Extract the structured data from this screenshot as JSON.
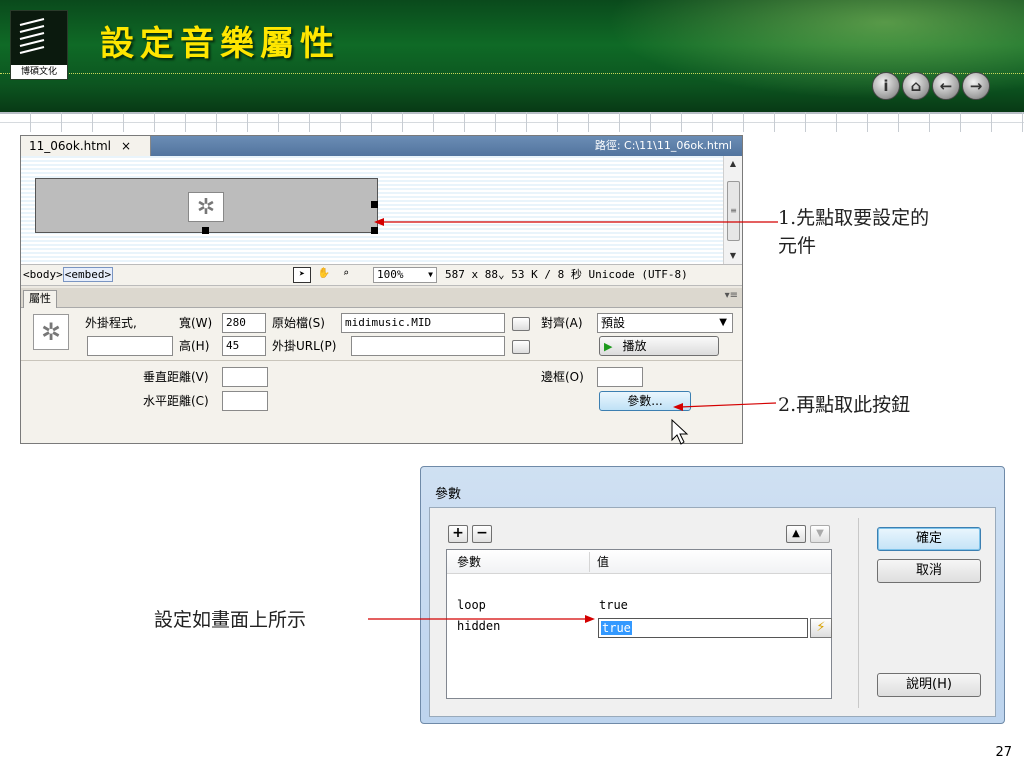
{
  "slide": {
    "title": "設定音樂屬性",
    "logo_text": "博碩文化",
    "page_number": "27",
    "nav_buttons": [
      {
        "icon": "info-icon",
        "glyph": "i"
      },
      {
        "icon": "home-icon",
        "glyph": "⌂"
      },
      {
        "icon": "back-arrow-icon",
        "glyph": "←"
      },
      {
        "icon": "forward-arrow-icon",
        "glyph": "→"
      }
    ]
  },
  "document": {
    "tab_name": "11_06ok.html",
    "tab_close": "×",
    "path": "路徑: C:\\11\\11_06ok.html",
    "status": {
      "tag_body": "<body>",
      "tag_embed": "<embed>",
      "zoom": "100%",
      "info": "587 x 88⌄ 53 K / 8 秒 Unicode (UTF-8)"
    }
  },
  "properties": {
    "tab_label": "屬性",
    "plugin_label": "外掛程式,",
    "width_label": "寬(W)",
    "width_value": "280",
    "height_label": "高(H)",
    "height_value": "45",
    "name_value": "",
    "src_label": "原始檔(S)",
    "src_value": "midimusic.MID",
    "plugin_url_label": "外掛URL(P)",
    "plugin_url_value": "",
    "align_label": "對齊(A)",
    "align_value": "預設",
    "play_label": "播放",
    "vspace_label": "垂直距離(V)",
    "vspace_value": "",
    "hspace_label": "水平距離(C)",
    "hspace_value": "",
    "border_label": "邊框(O)",
    "border_value": "",
    "params_button": "參數..."
  },
  "callouts": {
    "step1": "1.先點取要設定的",
    "step1_cont": "元件",
    "step2": "2.再點取此按鈕",
    "step3": "設定如畫面上所示"
  },
  "dialog": {
    "title": "參數",
    "add": "+",
    "remove": "−",
    "up": "▲",
    "down": "▼",
    "col_param": "參數",
    "col_value": "值",
    "rows": [
      {
        "param": "loop",
        "value": "true"
      },
      {
        "param": "hidden",
        "value": "true"
      }
    ],
    "ok": "確定",
    "cancel": "取消",
    "help": "說明(H)"
  }
}
